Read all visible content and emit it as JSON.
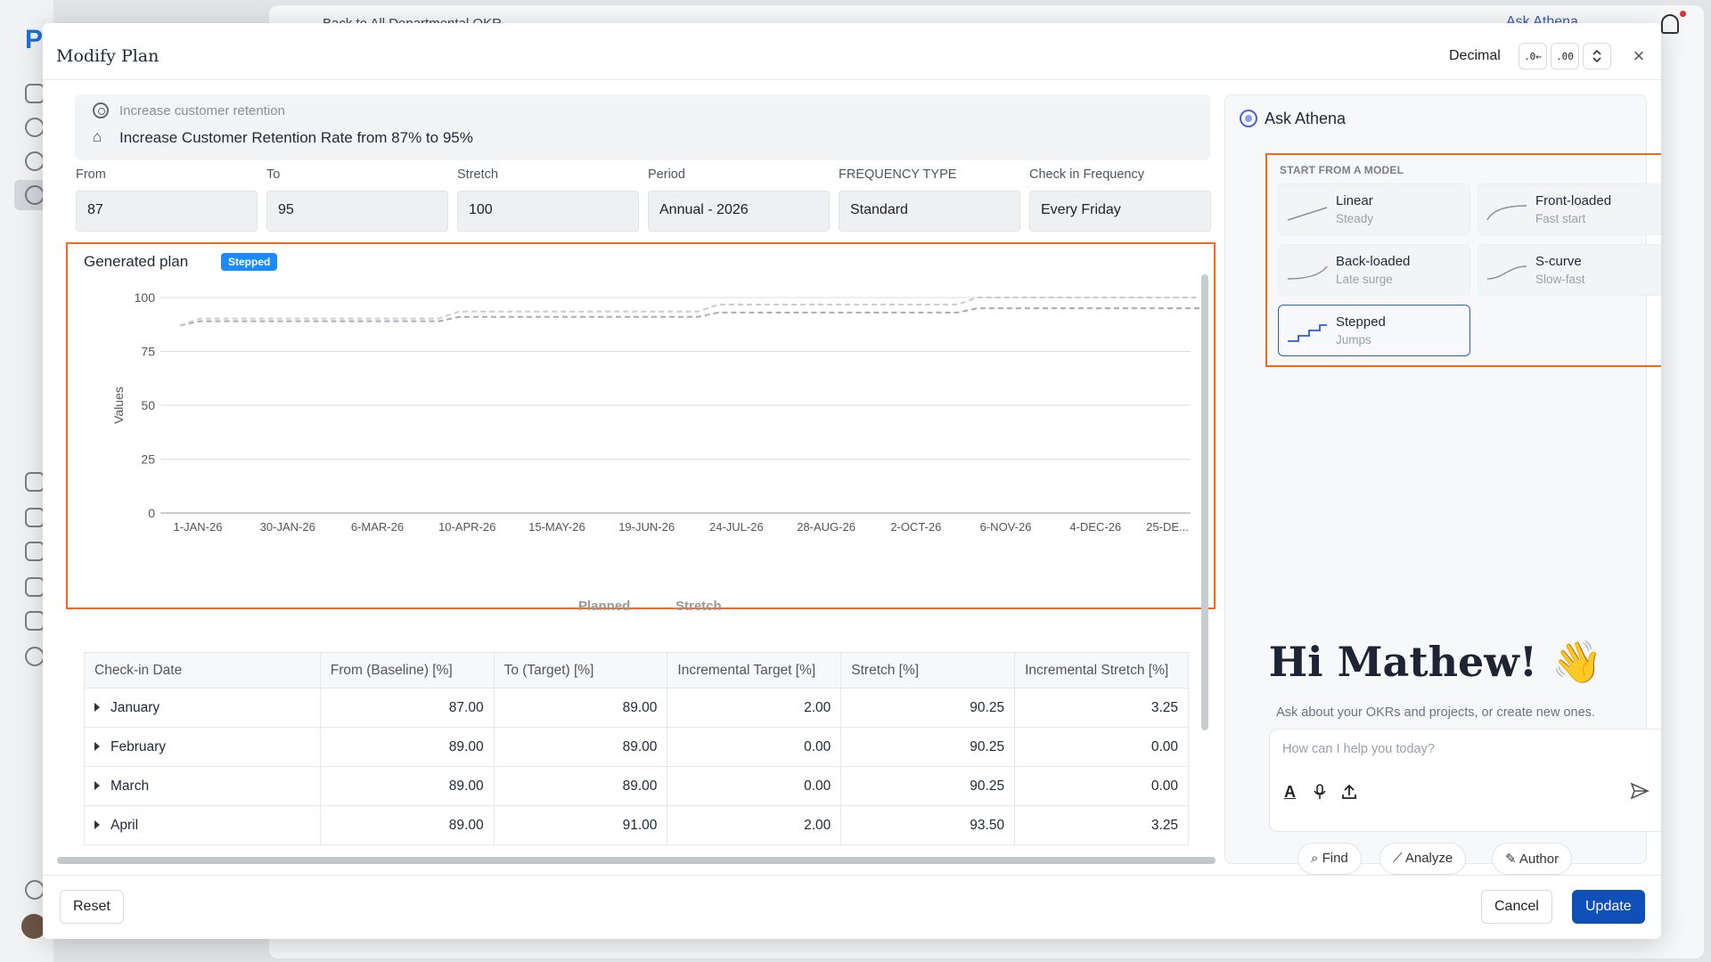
{
  "background": {
    "logo": "P",
    "breadcrumb": "Back to All Departmental OKR",
    "ask_link": "Ask Athena"
  },
  "modal": {
    "title": "Modify Plan",
    "decimal_label": "Decimal",
    "decrease_decimal": ".0←",
    "increase_decimal": ".00",
    "close": "×"
  },
  "objective": {
    "parent": "Increase customer retention",
    "title": "Increase Customer Retention Rate from 87% to 95%"
  },
  "fields": [
    {
      "label": "From",
      "value": "87"
    },
    {
      "label": "To",
      "value": "95"
    },
    {
      "label": "Stretch",
      "value": "100"
    },
    {
      "label": "Period",
      "value": "Annual - 2026"
    },
    {
      "label": "FREQUENCY TYPE",
      "value": "Standard"
    },
    {
      "label": "Check in Frequency",
      "value": "Every Friday"
    }
  ],
  "plan": {
    "heading": "Generated plan",
    "badge": "Stepped",
    "legend": [
      "Planned",
      "Stretch"
    ]
  },
  "chart_data": {
    "type": "line",
    "ylabel": "Values",
    "ylim": [
      0,
      100
    ],
    "yticks": [
      0,
      25,
      50,
      75,
      100
    ],
    "x_ticks": [
      "1-JAN-26",
      "30-JAN-26",
      "6-MAR-26",
      "10-APR-26",
      "15-MAY-26",
      "19-JUN-26",
      "24-JUL-26",
      "28-AUG-26",
      "2-OCT-26",
      "6-NOV-26",
      "4-DEC-26",
      "25-DE..."
    ],
    "x": [
      "1-JAN-26",
      "8-JAN-26",
      "2-APR-26",
      "9-APR-26",
      "2-JUL-26",
      "9-JUL-26",
      "1-OCT-26",
      "8-OCT-26",
      "25-DEC-26"
    ],
    "series": [
      {
        "name": "Planned",
        "values": [
          87,
          89,
          89,
          91,
          91,
          93,
          93,
          95,
          95
        ]
      },
      {
        "name": "Stretch",
        "values": [
          87,
          90.25,
          90.25,
          93.5,
          93.5,
          96.75,
          96.75,
          100,
          100
        ]
      }
    ],
    "grid": true,
    "legend_position": "bottom"
  },
  "table": {
    "headers": [
      "Check-in Date",
      "From (Baseline) [%]",
      "To (Target) [%]",
      "Incremental Target [%]",
      "Stretch [%]",
      "Incremental Stretch [%]"
    ],
    "rows": [
      [
        "January",
        "87.00",
        "89.00",
        "2.00",
        "90.25",
        "3.25"
      ],
      [
        "February",
        "89.00",
        "89.00",
        "0.00",
        "90.25",
        "0.00"
      ],
      [
        "March",
        "89.00",
        "89.00",
        "0.00",
        "90.25",
        "0.00"
      ],
      [
        "April",
        "89.00",
        "91.00",
        "2.00",
        "93.50",
        "3.25"
      ]
    ]
  },
  "footer": {
    "reset": "Reset",
    "cancel": "Cancel",
    "update": "Update"
  },
  "athena": {
    "title": "Ask Athena",
    "models_heading": "START FROM A MODEL",
    "models": [
      {
        "name": "Linear",
        "sub": "Steady"
      },
      {
        "name": "Front-loaded",
        "sub": "Fast start"
      },
      {
        "name": "Back-loaded",
        "sub": "Late surge"
      },
      {
        "name": "S-curve",
        "sub": "Slow-fast"
      },
      {
        "name": "Stepped",
        "sub": "Jumps"
      }
    ],
    "greeting": "Hi Mathew! 👋",
    "greeting_sub": "Ask about your OKRs and projects, or create new ones.",
    "input_placeholder": "How can I help you today?",
    "chips": [
      "Find",
      "Analyze",
      "Author"
    ]
  },
  "colors": {
    "accent": "#0f4fb8",
    "highlight": "#f26b1d",
    "badge": "#1a8cff"
  }
}
